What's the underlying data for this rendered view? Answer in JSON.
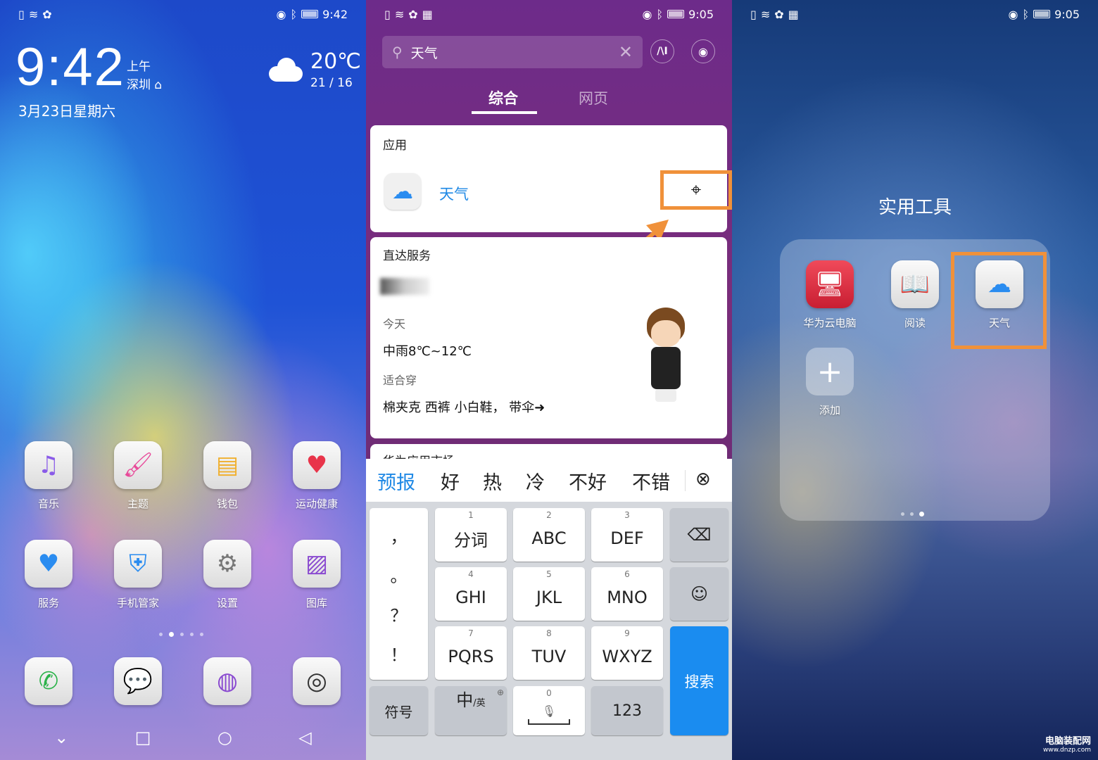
{
  "lockscreen": {
    "status_time": "9:42",
    "clock": "9:42",
    "ampm": "上午",
    "city": "深圳",
    "date": "3月23日星期六",
    "temp": "20℃",
    "temp_range": "21 / 16",
    "apps_row1": [
      {
        "label": "音乐",
        "icon": "music-icon"
      },
      {
        "label": "主题",
        "icon": "theme-brush-icon"
      },
      {
        "label": "钱包",
        "icon": "wallet-icon"
      },
      {
        "label": "运动健康",
        "icon": "health-heart-icon"
      }
    ],
    "apps_row2": [
      {
        "label": "服务",
        "icon": "service-heart-hand-icon"
      },
      {
        "label": "手机管家",
        "icon": "shield-icon"
      },
      {
        "label": "设置",
        "icon": "gear-icon"
      },
      {
        "label": "图库",
        "icon": "gallery-icon"
      }
    ],
    "dock": [
      {
        "icon": "phone-icon"
      },
      {
        "icon": "message-icon"
      },
      {
        "icon": "browser-icon"
      },
      {
        "icon": "camera-icon"
      }
    ],
    "page_dots": 5,
    "active_page": 2
  },
  "search": {
    "status_time": "9:05",
    "query": "天气",
    "tabs": [
      {
        "label": "综合",
        "active": true
      },
      {
        "label": "网页",
        "active": false
      }
    ],
    "apps_section": {
      "title": "应用",
      "app_name": "天气"
    },
    "direct_section": {
      "title": "直达服务",
      "today": "今天",
      "weather": "中雨8℃~12℃",
      "wear_title": "适合穿",
      "wear": "棉夹克 西裤 小白鞋， 带伞➜"
    },
    "next_section": {
      "title": "华为应用市场"
    },
    "candidates": [
      "预报",
      "好",
      "热",
      "冷",
      "不好",
      "不错"
    ],
    "punct": [
      "，",
      "。",
      "？",
      "！"
    ],
    "keys": [
      {
        "n": "1",
        "l": "分词"
      },
      {
        "n": "2",
        "l": "ABC"
      },
      {
        "n": "3",
        "l": "DEF"
      },
      {
        "n": "4",
        "l": "GHI"
      },
      {
        "n": "5",
        "l": "JKL"
      },
      {
        "n": "6",
        "l": "MNO"
      },
      {
        "n": "7",
        "l": "PQRS"
      },
      {
        "n": "8",
        "l": "TUV"
      },
      {
        "n": "9",
        "l": "WXYZ"
      }
    ],
    "symbol_key": "符号",
    "lang_key": "中",
    "lang_sub": "/英",
    "space_num": "0",
    "num_key": "123",
    "search_key": "搜索"
  },
  "folder": {
    "status_time": "9:05",
    "title": "实用工具",
    "apps": [
      {
        "label": "华为云电脑",
        "icon": "cloud-pc-icon"
      },
      {
        "label": "阅读",
        "icon": "book-icon"
      },
      {
        "label": "天气",
        "icon": "weather-icon"
      },
      {
        "label": "添加",
        "icon": "plus-icon"
      }
    ],
    "page_dots": 3,
    "active_page": 3
  },
  "watermark": {
    "name": "电脑装配网",
    "url": "www.dnzp.com"
  },
  "colors": {
    "highlight": "#f0913a",
    "accent_blue": "#1e88e5",
    "search_key": "#1a8cf0"
  }
}
